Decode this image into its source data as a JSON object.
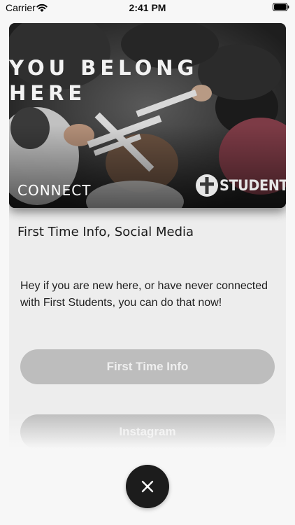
{
  "status_bar": {
    "carrier": "Carrier",
    "time": "2:41 PM",
    "wifi_icon": "wifi-icon",
    "battery_icon": "battery-icon"
  },
  "card": {
    "image": {
      "headline_line1": "YOU BELONG",
      "headline_line2": "HERE",
      "caption": "CONNECT",
      "brand_text": "STUDENTS",
      "brand_icon": "cross-circle-icon"
    },
    "title": "First Time Info, Social Media",
    "description": "Hey if you are new here, or have never connected with First Students, you can do that now!",
    "buttons": [
      {
        "label": "First Time Info"
      },
      {
        "label": "Instagram"
      }
    ]
  },
  "close_button": {
    "icon": "close-icon"
  },
  "colors": {
    "button_bg": "#bdbdbd",
    "button_text": "#efefef",
    "card_bg": "#ededed",
    "fab_bg": "#1c1c1c"
  }
}
